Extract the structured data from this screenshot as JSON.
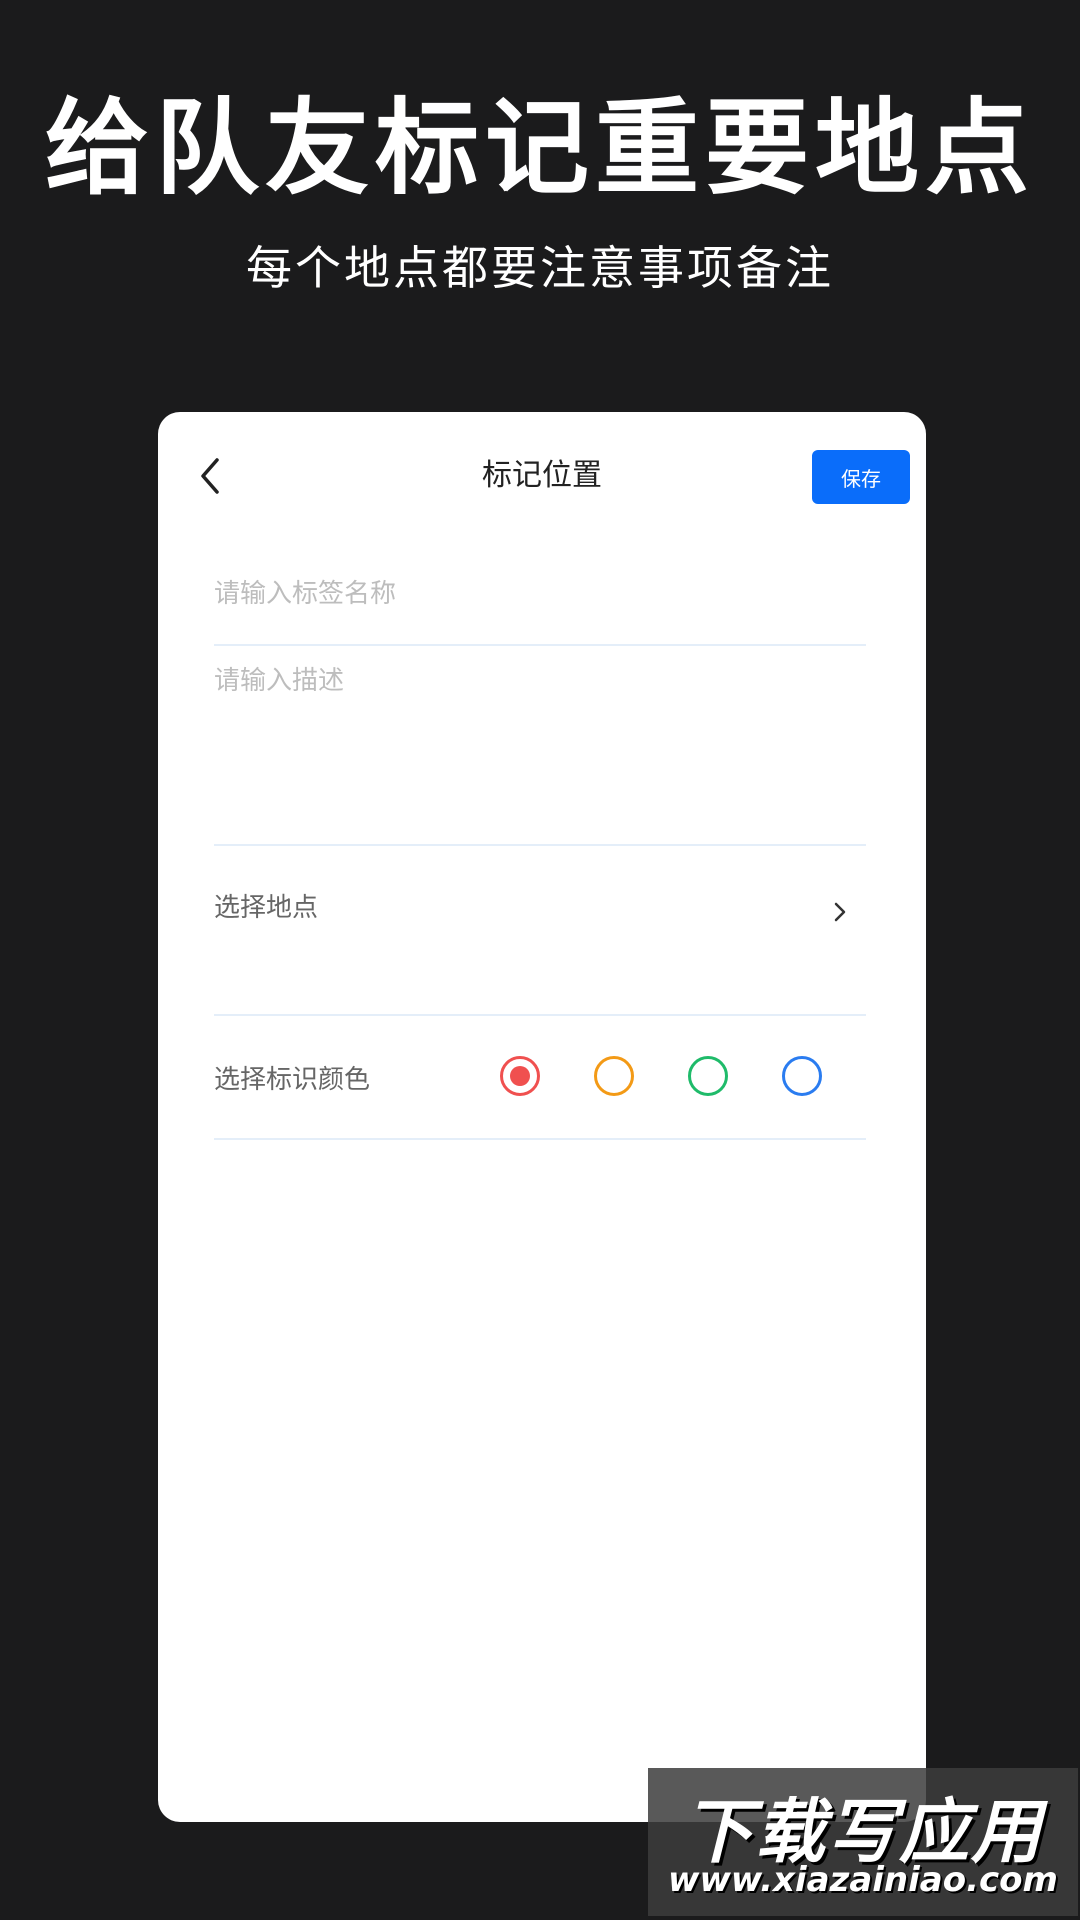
{
  "promo": {
    "title": "给队友标记重要地点",
    "subtitle": "每个地点都要注意事项备注"
  },
  "navbar": {
    "back_icon": "chevron-left-icon",
    "title": "标记位置",
    "save_label": "保存"
  },
  "form": {
    "name_placeholder": "请输入标签名称",
    "desc_placeholder": "请输入描述",
    "location_label": "选择地点",
    "location_icon": "chevron-right-icon",
    "color_label": "选择标识颜色",
    "colors": [
      {
        "name": "red",
        "hex": "#f0504f",
        "selected": true
      },
      {
        "name": "orange",
        "hex": "#f39a16",
        "selected": false
      },
      {
        "name": "green",
        "hex": "#1fbb6a",
        "selected": false
      },
      {
        "name": "blue",
        "hex": "#2a7cf0",
        "selected": false
      }
    ]
  },
  "theme": {
    "background": "#1b1b1c",
    "accent": "#0a6dfa"
  },
  "watermark": {
    "brand": "下载写应用",
    "url": "www.xiazainiao.com"
  }
}
